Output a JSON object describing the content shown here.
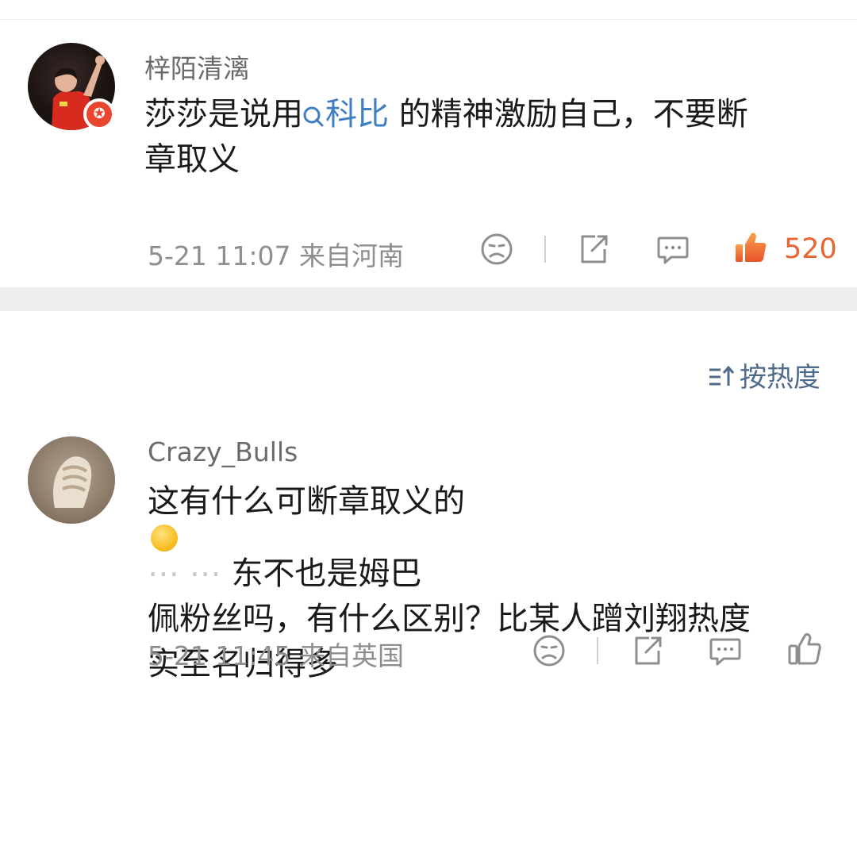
{
  "comments": [
    {
      "username": "梓陌清漓",
      "text_line1_pre": "莎莎是说用",
      "topic": "科比",
      "text_line1_post": " 的精神激励自己，不要断",
      "text_line2": "章取义",
      "meta": "5-21 11:07 来自河南",
      "likes": "520",
      "liked": true
    },
    {
      "username": "Crazy_Bulls",
      "text_line1_pre": "这有什么可断章取义的",
      "text_line1_post": "东不也是姆巴",
      "text_line2": "佩粉丝吗，有什么区别？比某人蹭刘翔热度",
      "text_line3": "实至名归得多",
      "meta": "5-21 11:45 来自英国",
      "likes": "",
      "liked": false
    }
  ],
  "sort": {
    "label": "按热度"
  },
  "colors": {
    "accent": "#e8652f",
    "topic": "#3f7ec3",
    "sort": "#4f6b8a"
  },
  "icons": [
    "dislike-icon",
    "share-icon",
    "comment-icon",
    "like-icon",
    "search-icon",
    "sort-icon"
  ]
}
